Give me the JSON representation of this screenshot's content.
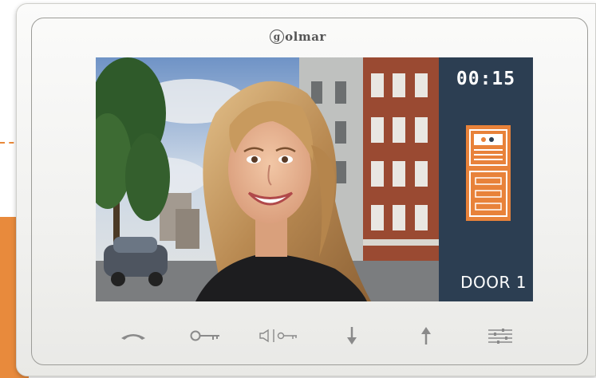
{
  "brand": {
    "mark": "g",
    "text": "olmar"
  },
  "screen": {
    "timer": "00:15",
    "door_label": "DOOR 1"
  },
  "colors": {
    "accent_orange": "#e88a3c",
    "panel_bg": "#2c3e52",
    "icon_gray": "#8a8a8a"
  },
  "buttons": [
    {
      "name": "hangup-button",
      "icon": "handset-icon"
    },
    {
      "name": "door-open-button",
      "icon": "key-icon"
    },
    {
      "name": "mute-gate-button",
      "icon": "speaker-key-icon"
    },
    {
      "name": "down-button",
      "icon": "arrow-down-icon"
    },
    {
      "name": "up-button",
      "icon": "arrow-up-icon"
    },
    {
      "name": "settings-button",
      "icon": "sliders-icon"
    }
  ]
}
